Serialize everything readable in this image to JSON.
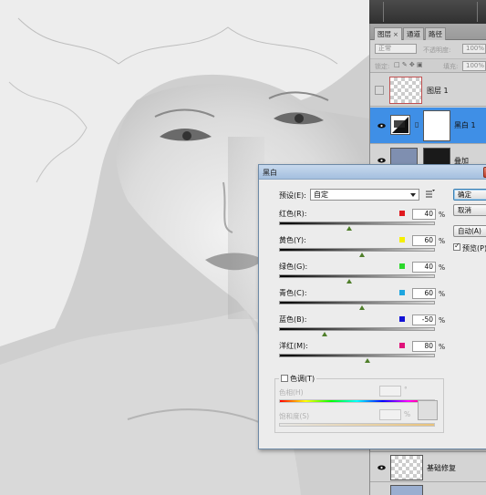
{
  "layers_panel": {
    "tabs": [
      {
        "label": "图层",
        "active": true
      },
      {
        "label": "通道",
        "active": false
      },
      {
        "label": "路径",
        "active": false
      }
    ],
    "blend_mode": "正常",
    "opacity_label": "不透明度:",
    "opacity_value": "100%",
    "lock_label": "锁定:",
    "fill_label": "填充:",
    "fill_value": "100%",
    "layers": [
      {
        "name": "图层 1",
        "visible": false,
        "selected": false
      },
      {
        "name": "黑白 1",
        "visible": true,
        "selected": true
      },
      {
        "name": "叠加",
        "visible": true,
        "selected": false
      },
      {
        "name": "基础修复",
        "visible": true,
        "selected": false
      }
    ]
  },
  "dialog": {
    "title": "黑白",
    "preset_label": "预设(E):",
    "preset_value": "自定",
    "buttons": {
      "ok": "确定",
      "cancel": "取消",
      "auto": "自动(A)"
    },
    "preview_label": "预览(P)",
    "preview_checked": true,
    "channels": [
      {
        "label": "红色(R):",
        "value": "40",
        "swatch": "#e0191e",
        "position": 0.45
      },
      {
        "label": "黄色(Y):",
        "value": "60",
        "swatch": "#f5ef00",
        "position": 0.53
      },
      {
        "label": "绿色(G):",
        "value": "40",
        "swatch": "#2bd82b",
        "position": 0.45
      },
      {
        "label": "青色(C):",
        "value": "60",
        "swatch": "#1ea6e0",
        "position": 0.53
      },
      {
        "label": "蓝色(B):",
        "value": "-50",
        "swatch": "#1212d6",
        "position": 0.29
      },
      {
        "label": "洋红(M):",
        "value": "80",
        "swatch": "#e0127a",
        "position": 0.57
      }
    ],
    "percent": "%",
    "tint": {
      "label": "色调(T)",
      "checked": false,
      "hue_label": "色相(H)",
      "hue_unit": "°",
      "saturation_label": "饱和度(S)",
      "saturation_unit": "%"
    }
  }
}
